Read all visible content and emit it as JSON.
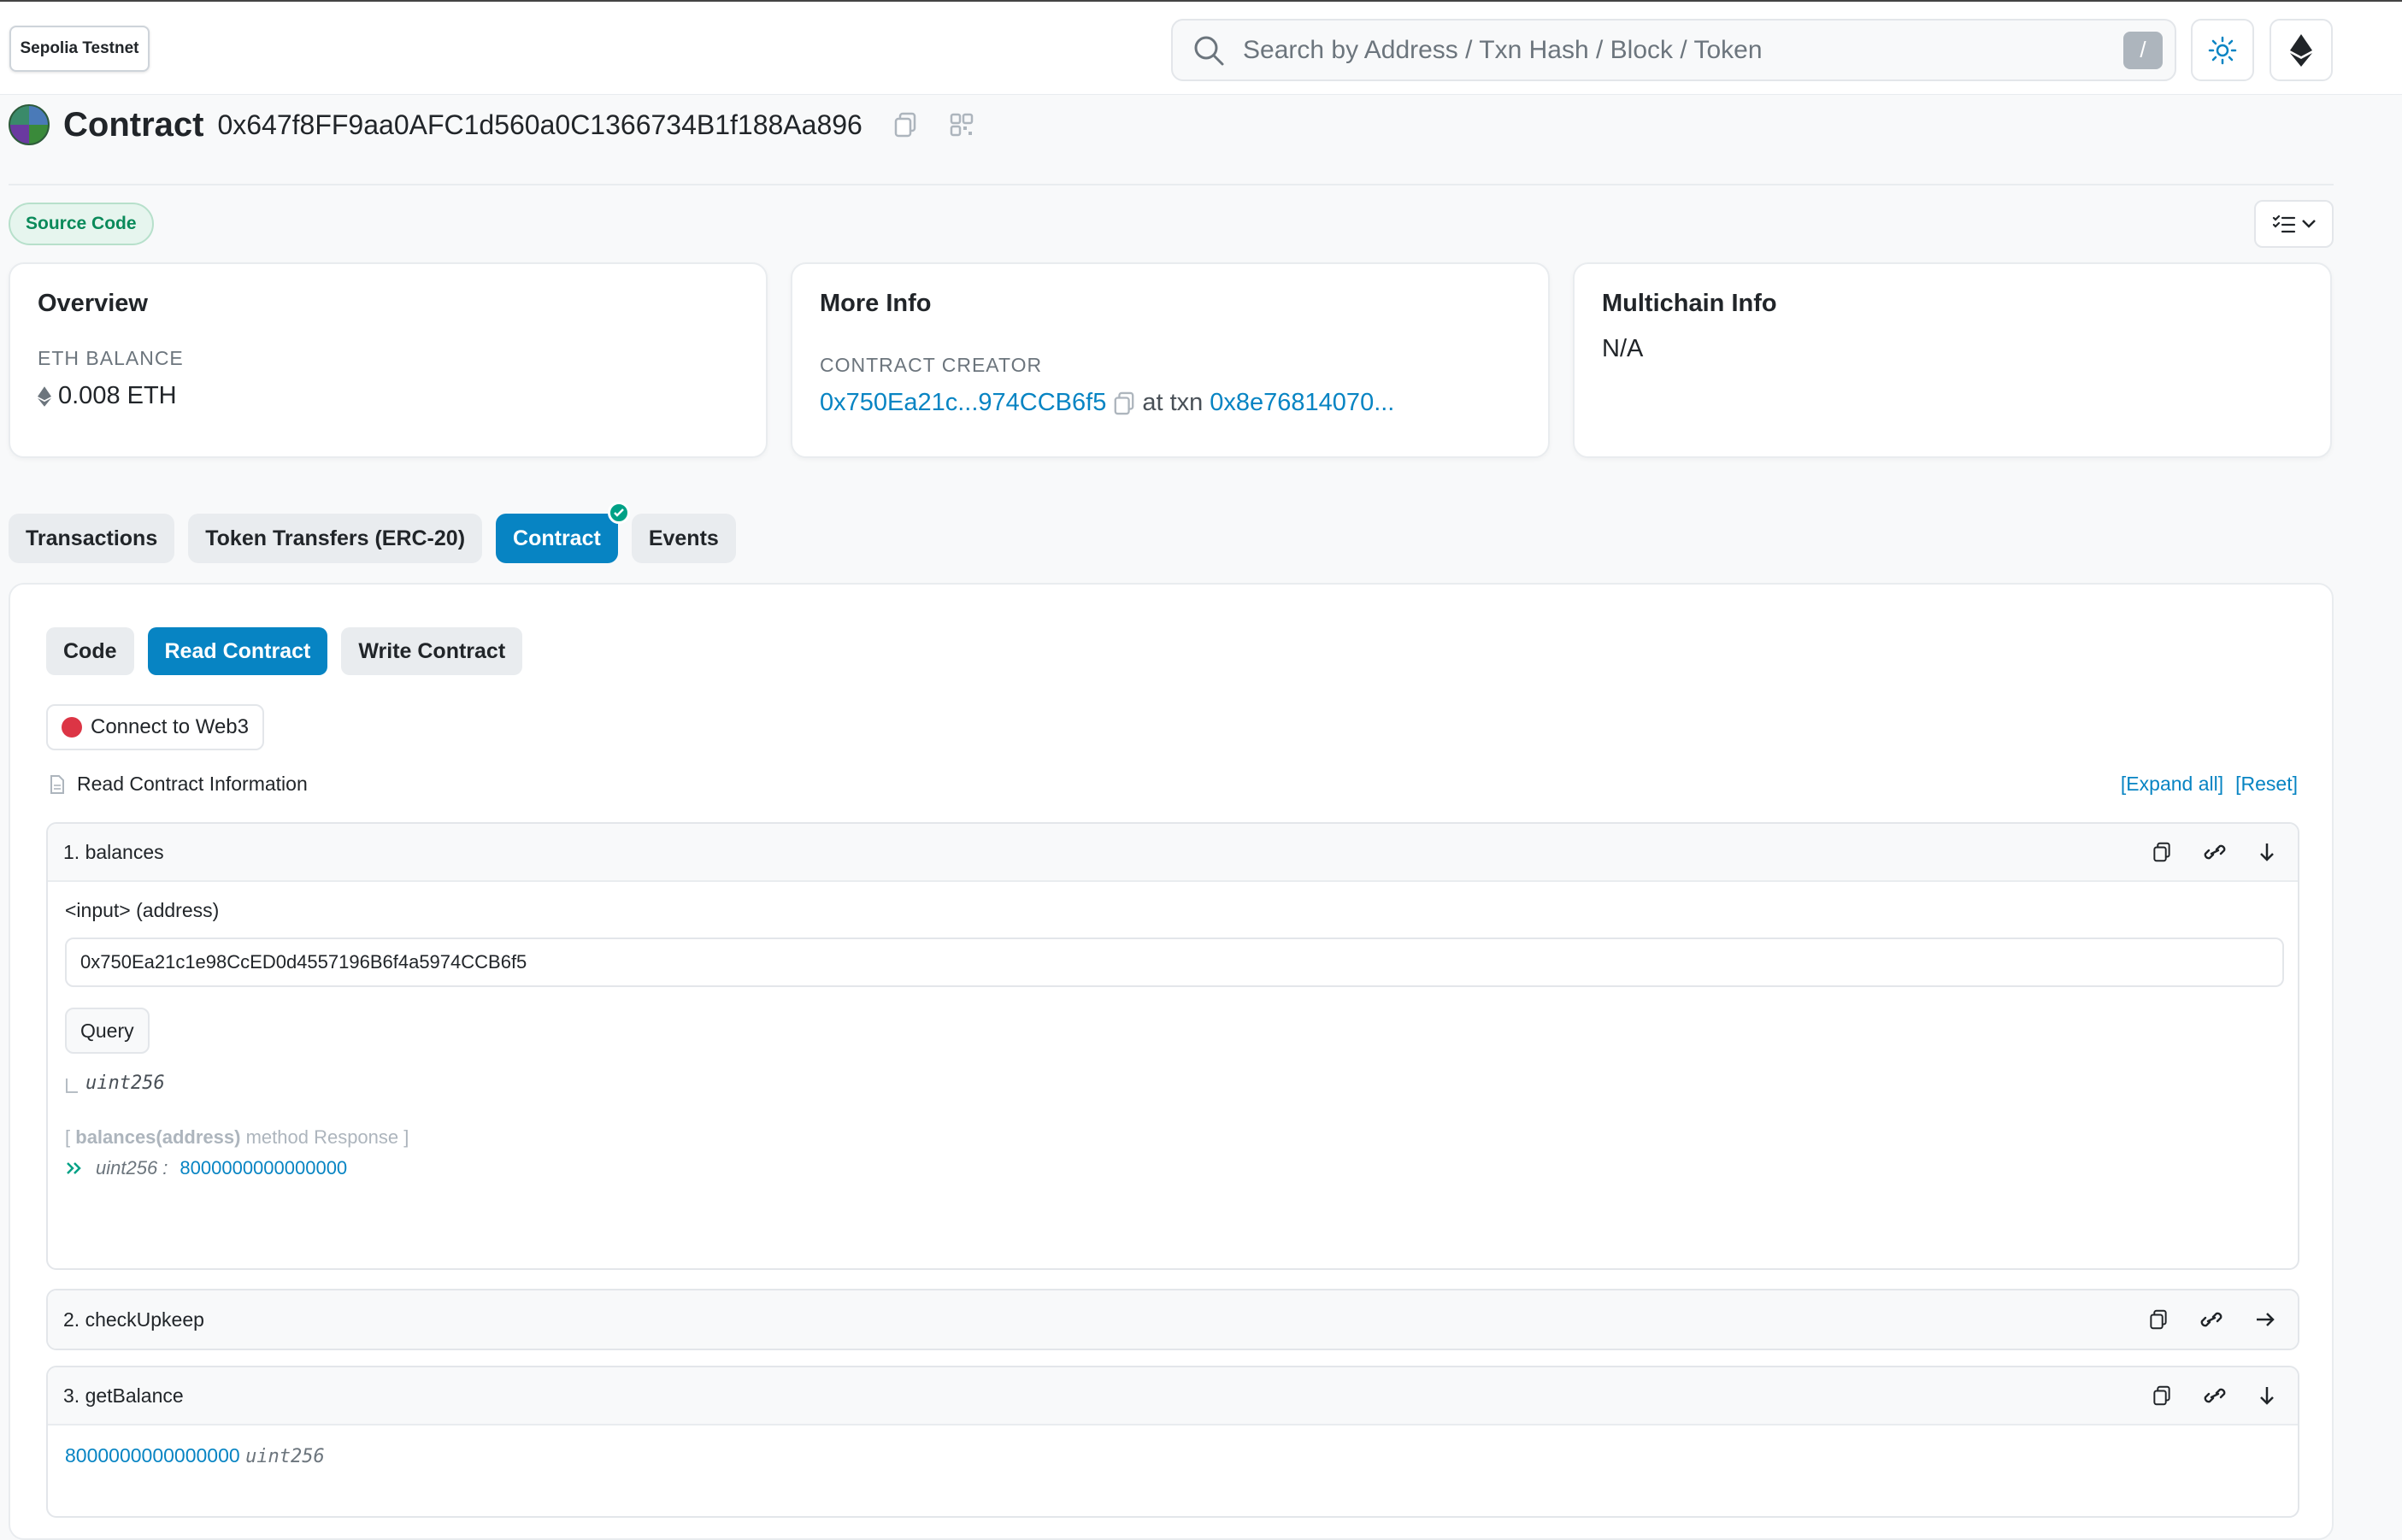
{
  "network": "Sepolia Testnet",
  "search": {
    "placeholder": "Search by Address / Txn Hash / Block / Token",
    "shortcut": "/"
  },
  "header": {
    "title": "Contract",
    "address": "0x647f8FF9aa0AFC1d560a0C1366734B1f188Aa896"
  },
  "source_badge": "Source Code",
  "overview": {
    "title": "Overview",
    "label": "ETH BALANCE",
    "value": "0.008 ETH"
  },
  "more_info": {
    "title": "More Info",
    "label": "CONTRACT CREATOR",
    "creator": "0x750Ea21c...974CCB6f5",
    "at_txn": "at txn",
    "txn": "0x8e76814070..."
  },
  "multichain": {
    "title": "Multichain Info",
    "value": "N/A"
  },
  "tabs": [
    "Transactions",
    "Token Transfers (ERC-20)",
    "Contract",
    "Events"
  ],
  "subtabs": [
    "Code",
    "Read Contract",
    "Write Contract"
  ],
  "connect_label": "Connect to Web3",
  "read_info_label": "Read Contract Information",
  "expand_all": "[Expand all]",
  "reset": "[Reset]",
  "functions": [
    {
      "name": "1. balances",
      "input_label": "<input> (address)",
      "input_value": "0x750Ea21c1e98CcED0d4557196B6f4a5974CCB6f5",
      "query_label": "Query",
      "return_type": "uint256",
      "response_open": "[",
      "response_method": "balances(address)",
      "response_text": "method Response ]",
      "response_type": "uint256 :",
      "response_value": "8000000000000000"
    },
    {
      "name": "2. checkUpkeep"
    },
    {
      "name": "3. getBalance",
      "value": "8000000000000000",
      "type": "uint256"
    }
  ]
}
